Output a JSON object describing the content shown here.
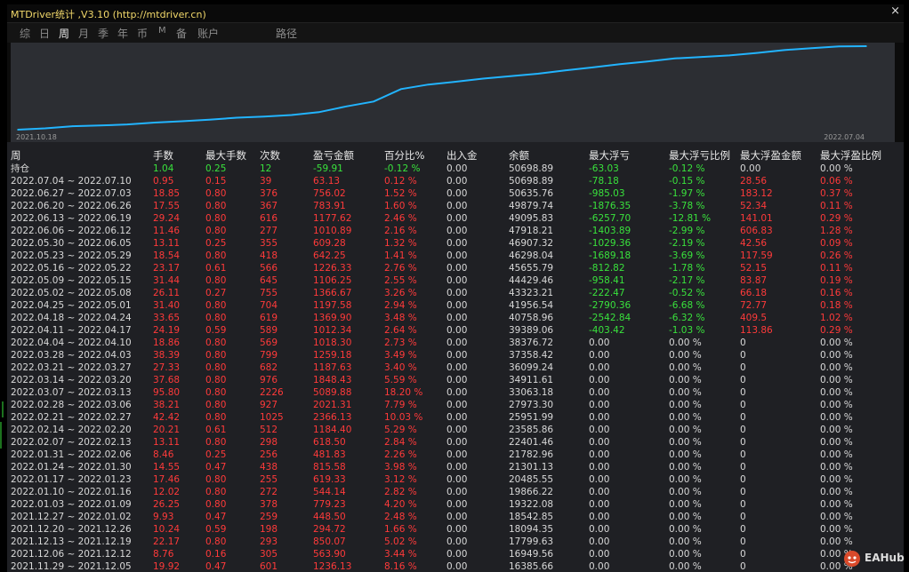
{
  "window": {
    "title": "MTDriver统计 ,V3.10 (http://mtdriver.cn)",
    "close": "×"
  },
  "tabs": [
    {
      "label": "综",
      "active": false
    },
    {
      "label": "日",
      "active": false
    },
    {
      "label": "周",
      "active": true
    },
    {
      "label": "月",
      "active": false
    },
    {
      "label": "季",
      "active": false
    },
    {
      "label": "年",
      "active": false
    },
    {
      "label": "币",
      "active": false
    },
    {
      "label": "M",
      "active": false
    },
    {
      "label": "备",
      "active": false
    },
    {
      "label": "账户",
      "active": false
    },
    {
      "label": "路径",
      "active": false
    }
  ],
  "chart_data": {
    "type": "line",
    "x_start_label": "2021.10.18",
    "x_end_label": "2022.07.04",
    "line_color": "#22b4ff",
    "series": [
      {
        "values": [
          16385.66,
          16949.56,
          17799.63,
          18094.35,
          18542.85,
          19322.08,
          19866.22,
          20485.55,
          21301.13,
          21782.96,
          22401.46,
          23585.86,
          25951.99,
          27973.3,
          33063.18,
          34911.61,
          36099.24,
          37358.42,
          38376.72,
          39389.06,
          40758.96,
          41956.54,
          43323.21,
          44429.46,
          45655.79,
          46298.04,
          46907.32,
          47918.21,
          49095.83,
          49879.74,
          50635.76,
          50698.89
        ]
      }
    ]
  },
  "table": {
    "headers": [
      "周",
      "手数",
      "最大手数",
      "次数",
      "盈亏金额",
      "百分比%",
      "出入金",
      "余额",
      "最大浮亏",
      "最大浮亏比例",
      "最大浮盈金额",
      "最大浮盈比例"
    ],
    "summary": [
      "持仓",
      "1.04",
      "0.25",
      "12",
      "-59.91",
      "-0.12 %",
      "0.00",
      "50698.89",
      "-63.03",
      "-0.12 %",
      "0.00",
      "0.00 %"
    ],
    "rows": [
      [
        "2022.07.04 ~ 2022.07.10",
        "0.95",
        "0.15",
        "39",
        "63.13",
        "0.12 %",
        "0.00",
        "50698.89",
        "-78.18",
        "-0.15 %",
        "28.56",
        "0.06 %"
      ],
      [
        "2022.06.27 ~ 2022.07.03",
        "18.85",
        "0.80",
        "376",
        "756.02",
        "1.52 %",
        "0.00",
        "50635.76",
        "-985.03",
        "-1.97 %",
        "183.12",
        "0.37 %"
      ],
      [
        "2022.06.20 ~ 2022.06.26",
        "17.55",
        "0.80",
        "367",
        "783.91",
        "1.60 %",
        "0.00",
        "49879.74",
        "-1876.35",
        "-3.78 %",
        "52.34",
        "0.11 %"
      ],
      [
        "2022.06.13 ~ 2022.06.19",
        "29.24",
        "0.80",
        "616",
        "1177.62",
        "2.46 %",
        "0.00",
        "49095.83",
        "-6257.70",
        "-12.81 %",
        "141.01",
        "0.29 %"
      ],
      [
        "2022.06.06 ~ 2022.06.12",
        "11.46",
        "0.80",
        "277",
        "1010.89",
        "2.16 %",
        "0.00",
        "47918.21",
        "-1403.89",
        "-2.99 %",
        "606.83",
        "1.28 %"
      ],
      [
        "2022.05.30 ~ 2022.06.05",
        "13.11",
        "0.25",
        "355",
        "609.28",
        "1.32 %",
        "0.00",
        "46907.32",
        "-1029.36",
        "-2.19 %",
        "42.56",
        "0.09 %"
      ],
      [
        "2022.05.23 ~ 2022.05.29",
        "18.54",
        "0.80",
        "418",
        "642.25",
        "1.41 %",
        "0.00",
        "46298.04",
        "-1689.18",
        "-3.69 %",
        "117.59",
        "0.26 %"
      ],
      [
        "2022.05.16 ~ 2022.05.22",
        "23.17",
        "0.61",
        "566",
        "1226.33",
        "2.76 %",
        "0.00",
        "45655.79",
        "-812.82",
        "-1.78 %",
        "52.15",
        "0.11 %"
      ],
      [
        "2022.05.09 ~ 2022.05.15",
        "31.44",
        "0.80",
        "645",
        "1106.25",
        "2.55 %",
        "0.00",
        "44429.46",
        "-958.41",
        "-2.17 %",
        "83.87",
        "0.19 %"
      ],
      [
        "2022.05.02 ~ 2022.05.08",
        "26.11",
        "0.27",
        "755",
        "1366.67",
        "3.26 %",
        "0.00",
        "43323.21",
        "-222.47",
        "-0.52 %",
        "66.18",
        "0.16 %"
      ],
      [
        "2022.04.25 ~ 2022.05.01",
        "31.40",
        "0.80",
        "704",
        "1197.58",
        "2.94 %",
        "0.00",
        "41956.54",
        "-2790.36",
        "-6.68 %",
        "72.77",
        "0.18 %"
      ],
      [
        "2022.04.18 ~ 2022.04.24",
        "33.65",
        "0.80",
        "619",
        "1369.90",
        "3.48 %",
        "0.00",
        "40758.96",
        "-2542.84",
        "-6.32 %",
        "409.5",
        "1.02 %"
      ],
      [
        "2022.04.11 ~ 2022.04.17",
        "24.19",
        "0.59",
        "589",
        "1012.34",
        "2.64 %",
        "0.00",
        "39389.06",
        "-403.42",
        "-1.03 %",
        "113.86",
        "0.29 %"
      ],
      [
        "2022.04.04 ~ 2022.04.10",
        "18.86",
        "0.80",
        "569",
        "1018.30",
        "2.73 %",
        "0.00",
        "38376.72",
        "0.00",
        "0.00 %",
        "0",
        "0.00 %"
      ],
      [
        "2022.03.28 ~ 2022.04.03",
        "38.39",
        "0.80",
        "799",
        "1259.18",
        "3.49 %",
        "0.00",
        "37358.42",
        "0.00",
        "0.00 %",
        "0",
        "0.00 %"
      ],
      [
        "2022.03.21 ~ 2022.03.27",
        "27.33",
        "0.80",
        "682",
        "1187.63",
        "3.40 %",
        "0.00",
        "36099.24",
        "0.00",
        "0.00 %",
        "0",
        "0.00 %"
      ],
      [
        "2022.03.14 ~ 2022.03.20",
        "37.68",
        "0.80",
        "976",
        "1848.43",
        "5.59 %",
        "0.00",
        "34911.61",
        "0.00",
        "0.00 %",
        "0",
        "0.00 %"
      ],
      [
        "2022.03.07 ~ 2022.03.13",
        "95.80",
        "0.80",
        "2226",
        "5089.88",
        "18.20 %",
        "0.00",
        "33063.18",
        "0.00",
        "0.00 %",
        "0",
        "0.00 %"
      ],
      [
        "2022.02.28 ~ 2022.03.06",
        "38.21",
        "0.80",
        "927",
        "2021.31",
        "7.79 %",
        "0.00",
        "27973.30",
        "0.00",
        "0.00 %",
        "0",
        "0.00 %"
      ],
      [
        "2022.02.21 ~ 2022.02.27",
        "42.42",
        "0.80",
        "1025",
        "2366.13",
        "10.03 %",
        "0.00",
        "25951.99",
        "0.00",
        "0.00 %",
        "0",
        "0.00 %"
      ],
      [
        "2022.02.14 ~ 2022.02.20",
        "20.21",
        "0.61",
        "512",
        "1184.40",
        "5.29 %",
        "0.00",
        "23585.86",
        "0.00",
        "0.00 %",
        "0",
        "0.00 %"
      ],
      [
        "2022.02.07 ~ 2022.02.13",
        "13.11",
        "0.80",
        "298",
        "618.50",
        "2.84 %",
        "0.00",
        "22401.46",
        "0.00",
        "0.00 %",
        "0",
        "0.00 %"
      ],
      [
        "2022.01.31 ~ 2022.02.06",
        "8.46",
        "0.25",
        "256",
        "481.83",
        "2.26 %",
        "0.00",
        "21782.96",
        "0.00",
        "0.00 %",
        "0",
        "0.00 %"
      ],
      [
        "2022.01.24 ~ 2022.01.30",
        "14.55",
        "0.47",
        "438",
        "815.58",
        "3.98 %",
        "0.00",
        "21301.13",
        "0.00",
        "0.00 %",
        "0",
        "0.00 %"
      ],
      [
        "2022.01.17 ~ 2022.01.23",
        "17.46",
        "0.80",
        "255",
        "619.33",
        "3.12 %",
        "0.00",
        "20485.55",
        "0.00",
        "0.00 %",
        "0",
        "0.00 %"
      ],
      [
        "2022.01.10 ~ 2022.01.16",
        "12.02",
        "0.80",
        "272",
        "544.14",
        "2.82 %",
        "0.00",
        "19866.22",
        "0.00",
        "0.00 %",
        "0",
        "0.00 %"
      ],
      [
        "2022.01.03 ~ 2022.01.09",
        "26.25",
        "0.80",
        "378",
        "779.23",
        "4.20 %",
        "0.00",
        "19322.08",
        "0.00",
        "0.00 %",
        "0",
        "0.00 %"
      ],
      [
        "2021.12.27 ~ 2022.01.02",
        "9.93",
        "0.47",
        "259",
        "448.50",
        "2.48 %",
        "0.00",
        "18542.85",
        "0.00",
        "0.00 %",
        "0",
        "0.00 %"
      ],
      [
        "2021.12.20 ~ 2021.12.26",
        "10.24",
        "0.59",
        "198",
        "294.72",
        "1.66 %",
        "0.00",
        "18094.35",
        "0.00",
        "0.00 %",
        "0",
        "0.00 %"
      ],
      [
        "2021.12.13 ~ 2021.12.19",
        "22.17",
        "0.80",
        "293",
        "850.07",
        "5.02 %",
        "0.00",
        "17799.63",
        "0.00",
        "0.00 %",
        "0",
        "0.00 %"
      ],
      [
        "2021.12.06 ~ 2021.12.12",
        "8.76",
        "0.16",
        "305",
        "563.90",
        "3.44 %",
        "0.00",
        "16949.56",
        "0.00",
        "0.00 %",
        "0",
        "0.00 %"
      ],
      [
        "2021.11.29 ~ 2021.12.05",
        "19.92",
        "0.47",
        "601",
        "1236.13",
        "8.16 %",
        "0.00",
        "16385.66",
        "0.00",
        "0.00 %",
        "0",
        "0.00 %"
      ]
    ]
  },
  "watermark": {
    "text": "EAHub"
  },
  "colors": {
    "profit": "#ff3a3a",
    "loss": "#39e23c",
    "neutral": "#d8d8d8"
  }
}
